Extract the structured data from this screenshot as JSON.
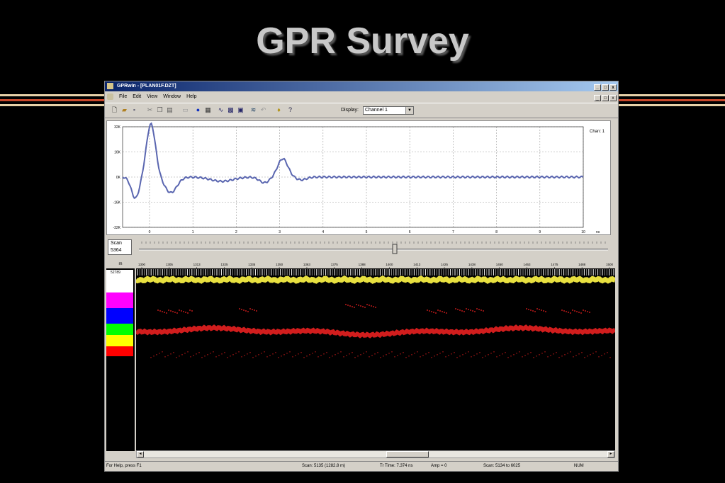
{
  "slide": {
    "title": "GPR Survey"
  },
  "window": {
    "title": "GPRwin - [PLAN01F.DZT]",
    "controls": [
      "_",
      "□",
      "x"
    ]
  },
  "menu": [
    "File",
    "Edit",
    "View",
    "Window",
    "Help"
  ],
  "toolbar": {
    "display_label": "Display:",
    "display_value": "Channel 1"
  },
  "plot": {
    "channel_label": "Chan: 1",
    "y_ticks": [
      "32K",
      "16K",
      "0K",
      "-16K",
      "-32K"
    ],
    "x_ticks": [
      "0",
      "1",
      "2",
      "3",
      "4",
      "5",
      "6",
      "7",
      "8",
      "9",
      "10"
    ],
    "x_unit": "ns",
    "line_color": "#5a66b0"
  },
  "scan": {
    "label": "Scan",
    "value": "5364"
  },
  "radar": {
    "header_left": "m",
    "value_left": "52789",
    "top_ticks": [
      "1300",
      "1305",
      "1313",
      "1325",
      "1335",
      "1350",
      "1363",
      "1375",
      "1388",
      "1400",
      "1413",
      "1425",
      "1438",
      "1450",
      "1463",
      "1475",
      "1488",
      "1500"
    ],
    "palette": [
      "#ffffff",
      "#ff00ff",
      "#0000ff",
      "#00ff00",
      "#ffff00",
      "#ff0000",
      "#000000"
    ],
    "band_colors": {
      "surface": "#e8e040",
      "reflector": "#e82020"
    }
  },
  "status": {
    "help": "For Help, press F1",
    "scan_info": "Scan: 5135 (1282.8 m)",
    "time_info": "Tr Time: 7.374 ns",
    "amp": "Amp = 0",
    "range": "Scan: 5134 to 6025",
    "num": "NUM"
  }
}
